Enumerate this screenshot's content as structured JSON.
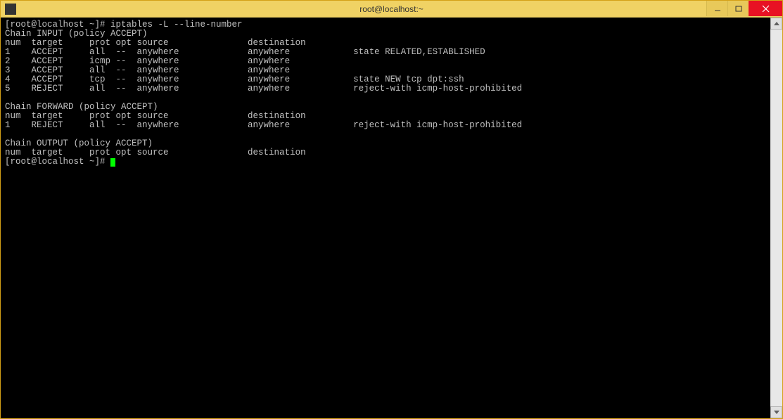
{
  "titlebar": {
    "title": "root@localhost:~"
  },
  "terminal": {
    "prompt1": "[root@localhost ~]# ",
    "command": "iptables -L --line-number",
    "prompt2": "[root@localhost ~]# ",
    "chains": {
      "input": {
        "header": "Chain INPUT (policy ACCEPT)",
        "cols": "num  target     prot opt source               destination         ",
        "rows": [
          "1    ACCEPT     all  --  anywhere             anywhere            state RELATED,ESTABLISHED ",
          "2    ACCEPT     icmp --  anywhere             anywhere            ",
          "3    ACCEPT     all  --  anywhere             anywhere            ",
          "4    ACCEPT     tcp  --  anywhere             anywhere            state NEW tcp dpt:ssh ",
          "5    REJECT     all  --  anywhere             anywhere            reject-with icmp-host-prohibited "
        ]
      },
      "forward": {
        "header": "Chain FORWARD (policy ACCEPT)",
        "cols": "num  target     prot opt source               destination         ",
        "rows": [
          "1    REJECT     all  --  anywhere             anywhere            reject-with icmp-host-prohibited "
        ]
      },
      "output": {
        "header": "Chain OUTPUT (policy ACCEPT)",
        "cols": "num  target     prot opt source               destination         ",
        "rows": []
      }
    }
  }
}
